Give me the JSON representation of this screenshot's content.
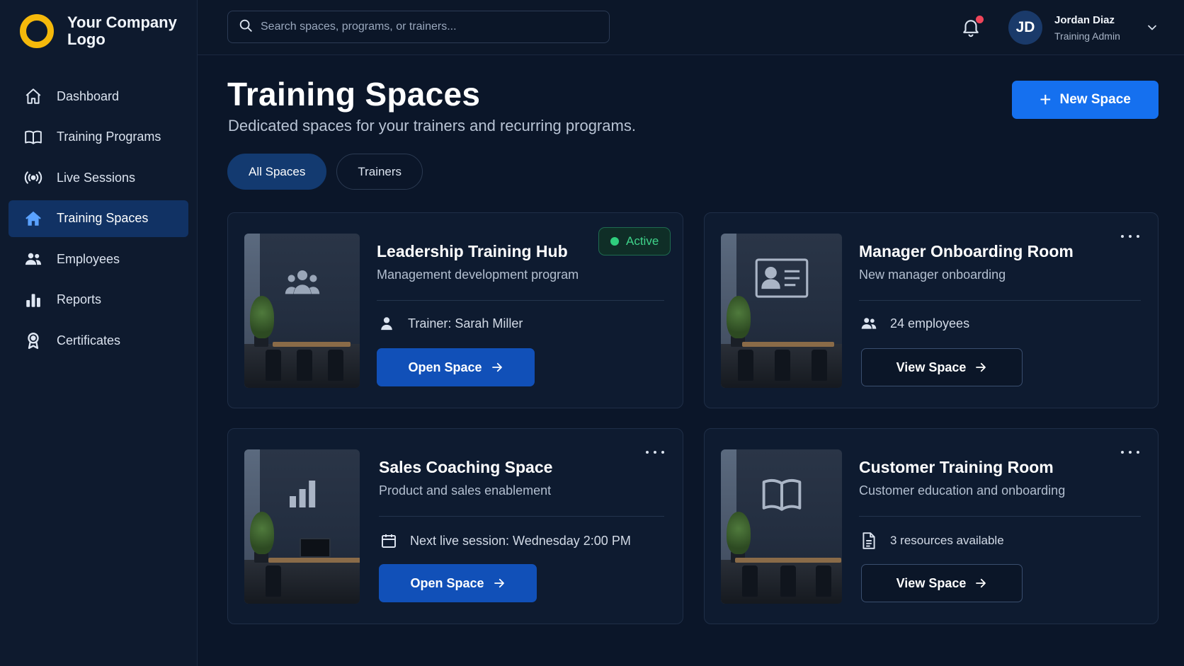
{
  "brand": {
    "logo_text": "Your Company Logo",
    "accent": "#f5b90b"
  },
  "sidebar": {
    "items": [
      {
        "label": "Dashboard",
        "icon": "home-icon"
      },
      {
        "label": "Training Programs",
        "icon": "book-icon"
      },
      {
        "label": "Live Sessions",
        "icon": "broadcast-icon"
      },
      {
        "label": "Training Spaces",
        "icon": "home-filled-icon",
        "active": true
      },
      {
        "label": "Employees",
        "icon": "users-icon"
      },
      {
        "label": "Reports",
        "icon": "bar-chart-icon"
      },
      {
        "label": "Certificates",
        "icon": "award-icon"
      }
    ]
  },
  "topbar": {
    "search_placeholder": "Search spaces, programs, or trainers...",
    "user": {
      "initials": "JD",
      "name": "Jordan Diaz",
      "role": "Training Admin"
    }
  },
  "header": {
    "title": "Training Spaces",
    "subtitle": "Dedicated spaces for your trainers and recurring programs.",
    "new_button": "New Space"
  },
  "tabs": [
    {
      "label": "All Spaces",
      "active": true
    },
    {
      "label": "Trainers",
      "active": false
    }
  ],
  "cards": [
    {
      "title": "Leadership Training Hub",
      "subtitle": "Management development program",
      "meta": "Trainer: Sarah Miller",
      "meta_icon": "user-icon",
      "button": "Open Space",
      "button_style": "primary",
      "badge": "Active",
      "wall_icon": "team-icon"
    },
    {
      "title": "Manager Onboarding Room",
      "subtitle": "New manager onboarding",
      "meta": "24 employees",
      "meta_icon": "users-icon",
      "button": "View Space",
      "button_style": "outline",
      "wall_icon": "id-card-icon"
    },
    {
      "title": "Sales Coaching Space",
      "subtitle": "Product and sales enablement",
      "meta": "Next live session: Wednesday 2:00 PM",
      "meta_icon": "calendar-icon",
      "button": "Open Space",
      "button_style": "primary",
      "wall_icon": "bar-chart-icon"
    },
    {
      "title": "Customer Training Room",
      "subtitle": "Customer education and onboarding",
      "meta": "3 resources available",
      "meta_icon": "document-icon",
      "button": "View Space",
      "button_style": "outline",
      "wall_icon": "open-book-icon"
    }
  ],
  "colors": {
    "primary": "#1570ef",
    "active_status": "#2fce7d",
    "notification": "#f0455a"
  }
}
